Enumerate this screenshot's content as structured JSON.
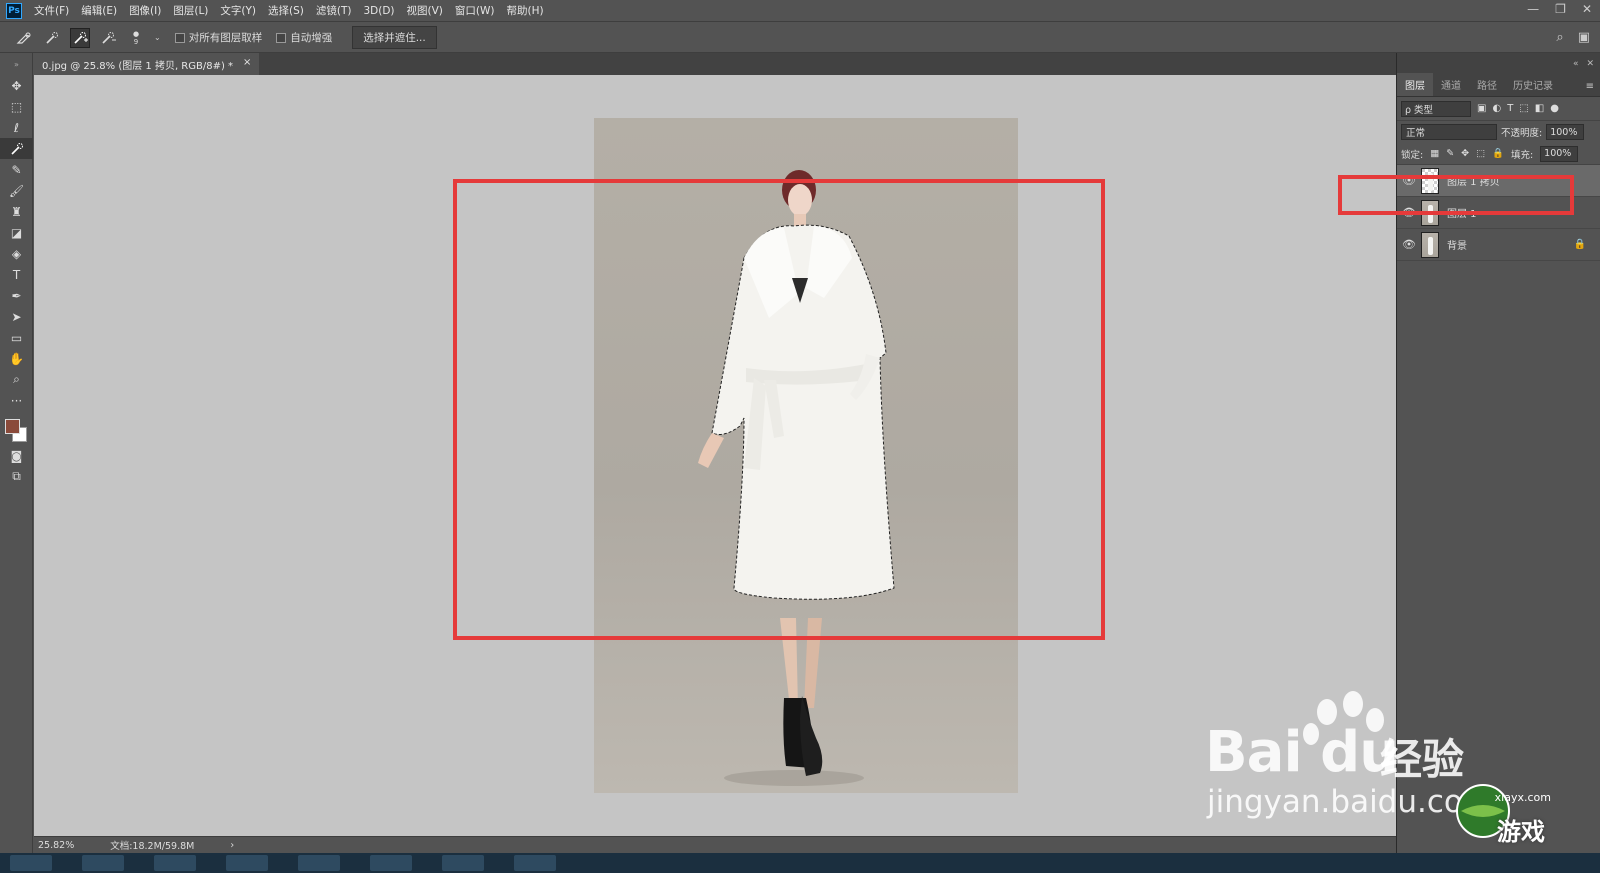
{
  "app": {
    "logo": "Ps"
  },
  "menu": [
    "文件(F)",
    "编辑(E)",
    "图像(I)",
    "图层(L)",
    "文字(Y)",
    "选择(S)",
    "滤镜(T)",
    "3D(D)",
    "视图(V)",
    "窗口(W)",
    "帮助(H)"
  ],
  "window_controls": [
    "—",
    "❐",
    "✕"
  ],
  "options": {
    "brush_size": "9",
    "sample_all_label": "对所有图层取样",
    "auto_enhance_label": "自动增强",
    "select_mask_button": "选择并遮住..."
  },
  "document": {
    "tab_title": "0.jpg @ 25.8% (图层 1 拷贝, RGB/8#) *",
    "tab_close": "×"
  },
  "status": {
    "zoom": "25.82%",
    "doc_size": "文档:18.2M/59.8M",
    "arrow": "›"
  },
  "panel": {
    "tabs": [
      "图层",
      "通道",
      "路径",
      "历史记录"
    ],
    "filter_kind": "ρ 类型",
    "blend_mode": "正常",
    "opacity_label": "不透明度:",
    "opacity_value": "100%",
    "lock_label": "锁定:",
    "fill_label": "填充:",
    "fill_value": "100%",
    "layers": [
      {
        "name": "图层 1 拷贝",
        "selected": true,
        "transparent": true,
        "locked": false
      },
      {
        "name": "图层 1",
        "selected": false,
        "transparent": false,
        "locked": false
      },
      {
        "name": "背景",
        "selected": false,
        "transparent": false,
        "locked": true
      }
    ]
  },
  "watermark": {
    "baidu": "Bai du",
    "jingyan": "经验",
    "url": "jingyan.baidu.com",
    "site_small": "xiayx.com",
    "site_big": "游戏"
  },
  "highlight_color": "#e53a3a",
  "accent_fg_color": "#8a4a3a"
}
